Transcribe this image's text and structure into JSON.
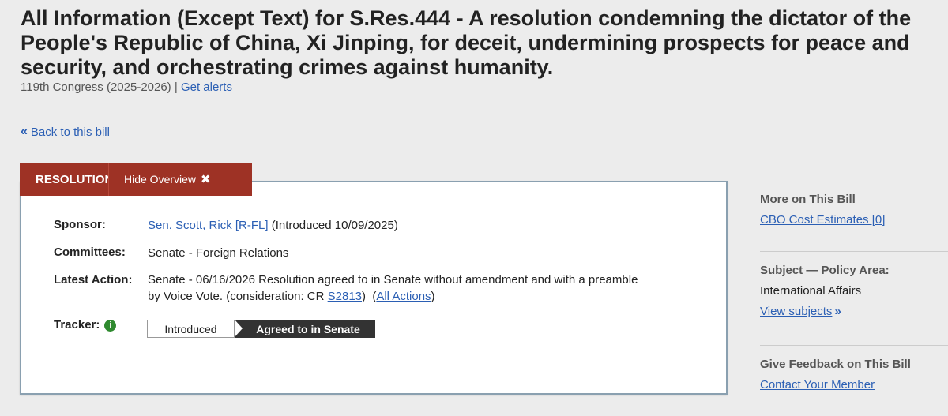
{
  "title": "All Information (Except Text) for S.Res.444 - A resolution condemning the dictator of the People's Republic of China, Xi Jinping, for deceit, undermining prospects for peace and security, and orchestrating crimes against humanity.",
  "congress": "119th Congress (2025-2026)",
  "separator": "|",
  "get_alerts": "Get alerts",
  "back_link": "Back to this bill",
  "tabs": {
    "active": "RESOLUTION",
    "hide": "Hide Overview"
  },
  "overview": {
    "sponsor_label": "Sponsor:",
    "sponsor_link": "Sen. Scott, Rick [R-FL]",
    "sponsor_intro": "(Introduced 10/09/2025)",
    "committees_label": "Committees:",
    "committees_value": "Senate - Foreign Relations",
    "latest_label": "Latest Action:",
    "latest_line1": "Senate - 06/16/2026 Resolution agreed to in Senate without amendment and with a preamble",
    "latest_line2_pre": "by Voice Vote. (consideration: CR",
    "latest_cr_link": "S2813",
    "latest_paren_open": ")  (",
    "latest_all_actions": "All Actions",
    "latest_paren_close": ")",
    "tracker_label": "Tracker:",
    "tracker_steps": [
      "Introduced",
      "Agreed to in Senate"
    ],
    "tracker_current_index": 1
  },
  "sidebar": {
    "more_heading": "More on This Bill",
    "cbo_link": "CBO Cost Estimates [0]",
    "subject_heading": "Subject — Policy Area:",
    "subject_value": "International Affairs",
    "view_subjects": "View subjects",
    "feedback_heading": "Give Feedback on This Bill",
    "contact_link": "Contact Your Member"
  },
  "colors": {
    "accent_red": "#9e3225",
    "link_blue": "#2b5fb4",
    "tracker_dark": "#333333",
    "info_green": "#2f8a2f"
  }
}
